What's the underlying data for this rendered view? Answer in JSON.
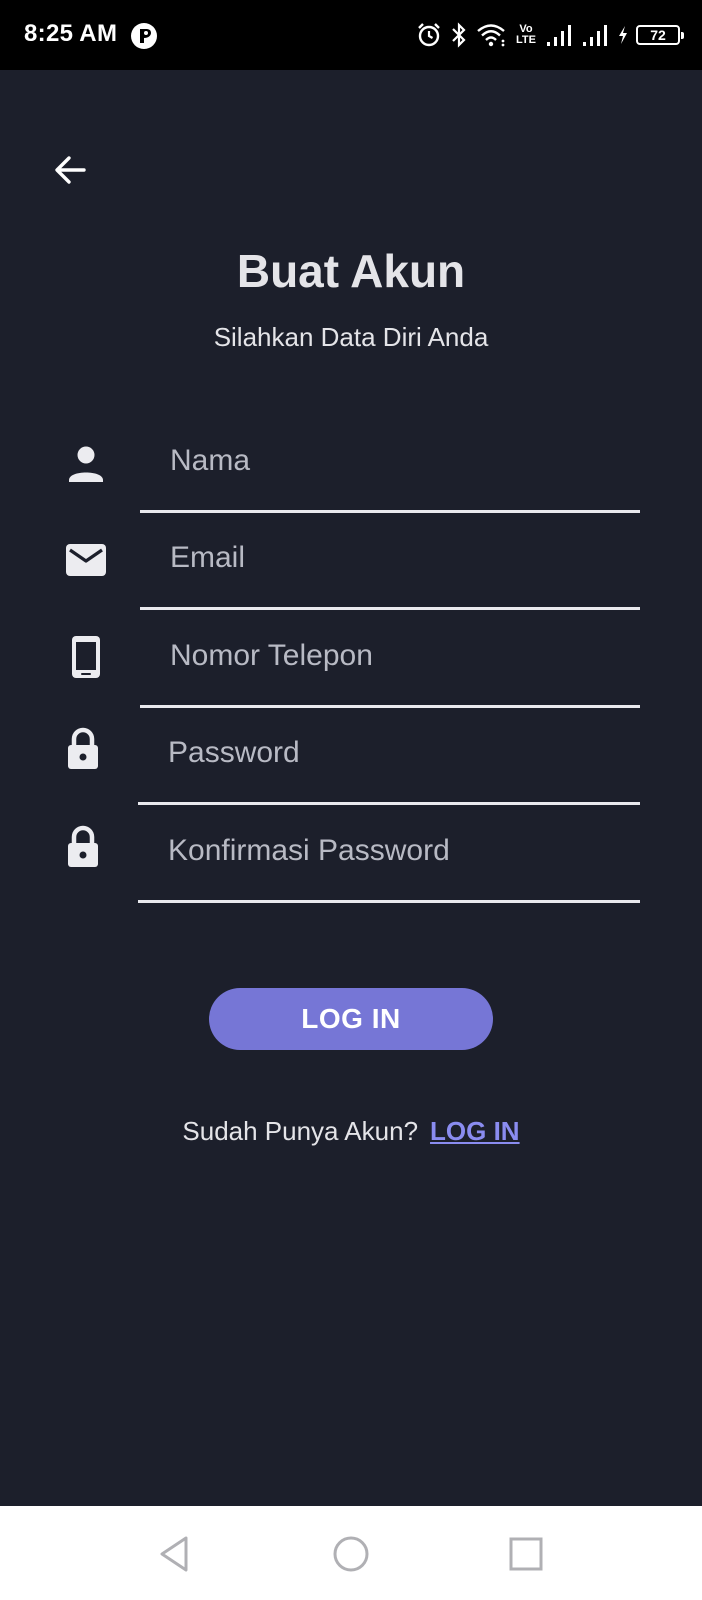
{
  "status_bar": {
    "time": "8:25 AM",
    "volte_top": "Vo",
    "volte_bottom": "LTE",
    "battery_level": "72",
    "icons": [
      "app-icon",
      "alarm-icon",
      "bluetooth-icon",
      "wifi-icon",
      "signal-icon",
      "signal-icon",
      "charging-icon",
      "battery-icon"
    ]
  },
  "header": {
    "back_icon": "arrow-left-icon",
    "title": "Buat Akun",
    "subtitle": "Silahkan Data Diri Anda"
  },
  "form": {
    "fields": [
      {
        "icon": "person-icon",
        "placeholder": "Nama",
        "value": ""
      },
      {
        "icon": "mail-icon",
        "placeholder": "Email",
        "value": ""
      },
      {
        "icon": "phone-icon",
        "placeholder": "Nomor Telepon",
        "value": ""
      },
      {
        "icon": "lock-icon",
        "placeholder": "Password",
        "value": ""
      },
      {
        "icon": "lock-icon",
        "placeholder": "Konfirmasi Password",
        "value": ""
      }
    ],
    "submit_label": "LOG IN"
  },
  "footer": {
    "prompt": "Sudah Punya Akun?",
    "link_label": "LOG IN"
  },
  "navbar": {
    "icons": [
      "nav-back-icon",
      "nav-home-icon",
      "nav-recents-icon"
    ]
  },
  "colors": {
    "background": "#1c1f2b",
    "accent": "#7676d6",
    "link": "#8a8cf0",
    "text": "#e4e4e8"
  }
}
